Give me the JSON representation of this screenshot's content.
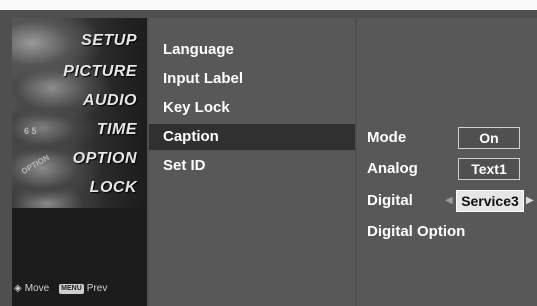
{
  "categories": [
    {
      "label": "SETUP"
    },
    {
      "label": "PICTURE"
    },
    {
      "label": "AUDIO"
    },
    {
      "label": "TIME"
    },
    {
      "label": "OPTION"
    },
    {
      "label": "LOCK"
    }
  ],
  "category_art": {
    "time_digits": "6 5",
    "option_badge": "OPTION"
  },
  "hints": {
    "move_icon": "◈",
    "move_label": "Move",
    "menu_key": "MENU",
    "prev_label": "Prev"
  },
  "menu_items": [
    {
      "label": "Language"
    },
    {
      "label": "Input Label"
    },
    {
      "label": "Key Lock"
    },
    {
      "label": "Caption",
      "selected": true
    },
    {
      "label": "Set ID"
    }
  ],
  "caption_options": {
    "mode": {
      "label": "Mode",
      "value": "On"
    },
    "analog": {
      "label": "Analog",
      "value": "Text1"
    },
    "digital": {
      "label": "Digital",
      "value": "Service3",
      "left_arrow": "◀",
      "right_arrow": "▶"
    },
    "digital_option": {
      "label": "Digital Option"
    }
  },
  "colors": {
    "osd_background": "#4f4f4f",
    "category_panel": "#1c1c1c",
    "panel": "#585858",
    "selected_row": "#303030",
    "active_value": "#e6e6e6"
  }
}
